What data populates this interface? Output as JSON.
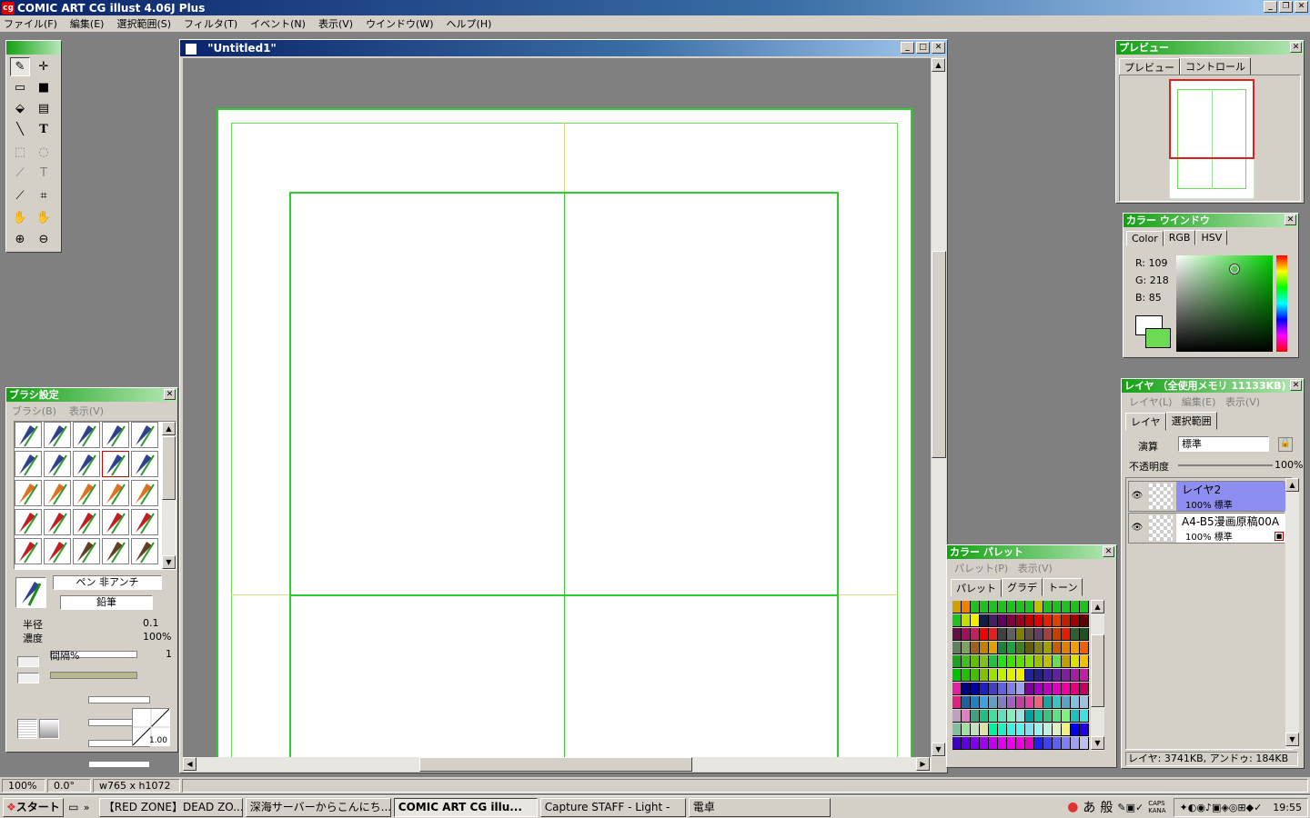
{
  "window": {
    "title": "COMIC ART CG illust 4.06J Plus",
    "app_icon": "cg"
  },
  "menu": [
    "ファイル(F)",
    "編集(E)",
    "選択範囲(S)",
    "フィルタ(T)",
    "イベント(N)",
    "表示(V)",
    "ウインドウ(W)",
    "ヘルプ(H)"
  ],
  "document": {
    "title": "\"Untitled1\""
  },
  "brush": {
    "title": "ブラシ設定",
    "menu": [
      "ブラシ(B)",
      "表示(V)"
    ],
    "name": "ペン 非アンチ",
    "type": "鉛筆",
    "radius_label": "半径",
    "radius_value": "0.1",
    "density_label": "濃度",
    "density_value": "100%",
    "interval_label": "間隔%",
    "interval_value": "1",
    "curve_value": "1.00"
  },
  "preview": {
    "title": "プレビュー",
    "tabs": [
      "プレビュー",
      "コントロール"
    ]
  },
  "color": {
    "title": "カラー ウインドウ",
    "tabs": [
      "Color",
      "RGB",
      "HSV"
    ],
    "r": "R: 109",
    "g": "G: 218",
    "b": "B:  85",
    "current": "#6dda55"
  },
  "layers": {
    "title": "レイヤ （全使用メモリ 11133KB)",
    "menu": [
      "レイヤ(L)",
      "編集(E)",
      "表示(V)"
    ],
    "tabs": [
      "レイヤ",
      "選択範囲"
    ],
    "blend_label": "演算",
    "blend_value": "標準",
    "opacity_label": "不透明度",
    "opacity_value": "100%",
    "items": [
      {
        "name": "レイヤ2",
        "info": "100% 標準",
        "selected": true
      },
      {
        "name": "A4-B5漫画原稿00A",
        "info": "100% 標準",
        "selected": false
      }
    ],
    "status": "レイヤ: 3741KB, アンドゥ: 184KB"
  },
  "palette": {
    "title": "カラー パレット",
    "menu": [
      "パレット(P)",
      "表示(V)"
    ],
    "tabs": [
      "パレット",
      "グラデ",
      "トーン"
    ]
  },
  "status": {
    "zoom": "100%",
    "angle": "0.0°",
    "size": "w765 x h1072"
  },
  "taskbar": {
    "start": "スタート",
    "tasks": [
      "【RED ZONE】DEAD ZO...",
      "深海サーバーからこんにち...",
      "COMIC ART CG illu...",
      "Capture STAFF - Light -",
      "電卓"
    ],
    "ime": [
      "あ",
      "般"
    ],
    "caps": "CAPS",
    "kana": "KANA",
    "clock": "19:55"
  }
}
